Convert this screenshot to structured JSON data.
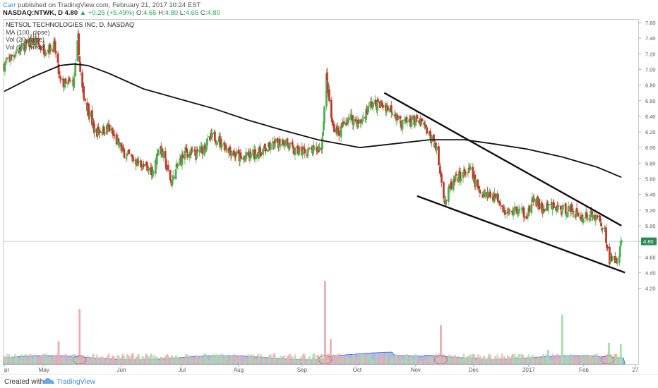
{
  "header": {
    "author": "Carr",
    "published": "published on TradingView.com, February 21, 2017 10:24 EST",
    "symbol": "NASDAQ:NTWK, D",
    "last": "4.80",
    "change": "+0.25 (+5.49%)",
    "open_label": "O:",
    "open": "4.65",
    "high_label": "H:",
    "high": "4.80",
    "low_label": "L:",
    "low": "4.65",
    "close_label": "C:",
    "close": "4.80"
  },
  "legend": {
    "title": "NETSOL TECHNOLOGIES INC, D, NASDAQ",
    "ma": "MA (100, close)",
    "vol1": "Vol (20, false)",
    "vol2": "Vol (20, false)"
  },
  "footer": {
    "created_with": "Created with",
    "brand": "TradingView"
  },
  "colors": {
    "up": "#4caf50",
    "down": "#c0392b",
    "ma": "#111111",
    "vol_ma_fill": "#8aa2ea",
    "vol_ma_line": "#3b63d8",
    "vol_up": "#a8dcaa",
    "vol_down": "#e8aeb0",
    "price_tag": "#2e8b57"
  },
  "chart_data": {
    "type": "candlestick",
    "title": "NETSOL TECHNOLOGIES INC, D, NASDAQ",
    "ylim": [
      4.15,
      7.65
    ],
    "y_ticks": [
      "7.60",
      "7.40",
      "7.20",
      "7.00",
      "6.80",
      "6.60",
      "6.40",
      "6.20",
      "6.00",
      "5.80",
      "5.60",
      "5.40",
      "5.20",
      "5.00",
      "4.80",
      "4.60",
      "4.40",
      "4.20"
    ],
    "x_ticks": [
      {
        "label": "pr",
        "day": 0
      },
      {
        "label": "May",
        "day": 57
      },
      {
        "label": "Jun",
        "day": 168
      },
      {
        "label": "Jul",
        "day": 255
      },
      {
        "label": "Aug",
        "day": 336
      },
      {
        "label": "Sep",
        "day": 427
      },
      {
        "label": "Oct",
        "day": 506
      },
      {
        "label": "Nov",
        "day": 590
      },
      {
        "label": "Dec",
        "day": 673
      },
      {
        "label": "2017",
        "day": 752
      },
      {
        "label": "Feb",
        "day": 831
      },
      {
        "label": "27",
        "day": 905
      }
    ],
    "last_price": "4.80",
    "keypoints": [
      [
        0,
        7.05
      ],
      [
        14,
        7.2
      ],
      [
        28,
        7.3
      ],
      [
        43,
        7.35
      ],
      [
        58,
        7.25
      ],
      [
        72,
        7.3
      ],
      [
        80,
        6.85
      ],
      [
        88,
        6.8
      ],
      [
        100,
        6.85
      ],
      [
        106,
        7.4
      ],
      [
        110,
        6.8
      ],
      [
        120,
        6.5
      ],
      [
        130,
        6.2
      ],
      [
        150,
        6.25
      ],
      [
        170,
        5.95
      ],
      [
        200,
        5.75
      ],
      [
        215,
        5.7
      ],
      [
        222,
        6.05
      ],
      [
        240,
        5.55
      ],
      [
        250,
        5.8
      ],
      [
        260,
        5.95
      ],
      [
        275,
        5.9
      ],
      [
        300,
        6.15
      ],
      [
        320,
        6.0
      ],
      [
        340,
        5.85
      ],
      [
        380,
        6.0
      ],
      [
        400,
        6.1
      ],
      [
        415,
        5.95
      ],
      [
        440,
        5.95
      ],
      [
        455,
        6.0
      ],
      [
        462,
        6.9
      ],
      [
        470,
        6.3
      ],
      [
        480,
        6.2
      ],
      [
        495,
        6.4
      ],
      [
        510,
        6.3
      ],
      [
        525,
        6.55
      ],
      [
        540,
        6.55
      ],
      [
        555,
        6.5
      ],
      [
        570,
        6.3
      ],
      [
        585,
        6.35
      ],
      [
        600,
        6.3
      ],
      [
        610,
        6.15
      ],
      [
        618,
        6.05
      ],
      [
        625,
        5.7
      ],
      [
        632,
        5.3
      ],
      [
        640,
        5.5
      ],
      [
        655,
        5.65
      ],
      [
        668,
        5.7
      ],
      [
        680,
        5.45
      ],
      [
        695,
        5.4
      ],
      [
        710,
        5.35
      ],
      [
        720,
        5.15
      ],
      [
        735,
        5.2
      ],
      [
        750,
        5.15
      ],
      [
        760,
        5.35
      ],
      [
        772,
        5.2
      ],
      [
        785,
        5.25
      ],
      [
        800,
        5.2
      ],
      [
        815,
        5.2
      ],
      [
        828,
        5.1
      ],
      [
        840,
        5.15
      ],
      [
        855,
        5.05
      ],
      [
        862,
        4.9
      ],
      [
        868,
        4.55
      ],
      [
        874,
        4.55
      ],
      [
        880,
        4.6
      ],
      [
        885,
        4.8
      ]
    ],
    "ma100": [
      [
        0,
        6.72
      ],
      [
        40,
        6.9
      ],
      [
        80,
        7.05
      ],
      [
        100,
        7.07
      ],
      [
        120,
        7.05
      ],
      [
        150,
        6.95
      ],
      [
        200,
        6.75
      ],
      [
        260,
        6.6
      ],
      [
        300,
        6.5
      ],
      [
        350,
        6.35
      ],
      [
        400,
        6.22
      ],
      [
        450,
        6.1
      ],
      [
        510,
        6.0
      ],
      [
        560,
        6.05
      ],
      [
        610,
        6.1
      ],
      [
        660,
        6.1
      ],
      [
        700,
        6.05
      ],
      [
        750,
        5.98
      ],
      [
        800,
        5.88
      ],
      [
        850,
        5.75
      ],
      [
        885,
        5.62
      ]
    ],
    "trendlines": [
      {
        "from": [
          545,
          6.7
        ],
        "to": [
          885,
          5.0
        ]
      },
      {
        "from": [
          592,
          5.38
        ],
        "to": [
          890,
          4.4
        ]
      }
    ],
    "volume_spikes": [
      {
        "day": 78,
        "h": 32,
        "dir": "down"
      },
      {
        "day": 108,
        "h": 78,
        "dir": "down"
      },
      {
        "day": 460,
        "h": 118,
        "dir": "down"
      },
      {
        "day": 468,
        "h": 35,
        "dir": "down"
      },
      {
        "day": 626,
        "h": 55,
        "dir": "down"
      },
      {
        "day": 800,
        "h": 70,
        "dir": "up"
      },
      {
        "day": 780,
        "h": 20,
        "dir": "up"
      },
      {
        "day": 867,
        "h": 30,
        "dir": "up"
      },
      {
        "day": 884,
        "h": 28,
        "dir": "up"
      }
    ]
  }
}
